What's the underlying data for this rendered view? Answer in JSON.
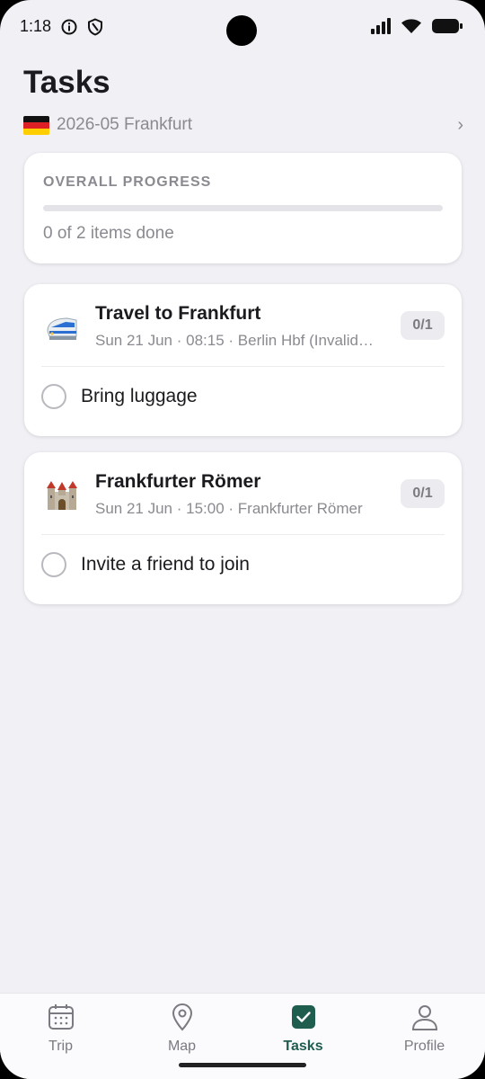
{
  "status": {
    "time": "1:18"
  },
  "header": {
    "title": "Tasks",
    "trip_name": "2026-05 Frankfurt",
    "chevron": "›"
  },
  "progress": {
    "label": "OVERALL PROGRESS",
    "text": "0 of 2 items done",
    "fraction": 0
  },
  "events": [
    {
      "emoji": "🚄",
      "title": "Travel to Frankfurt",
      "subtitle": "Sun 21 Jun · 08:15 · Berlin Hbf (Invalid…",
      "count": "0/1",
      "tasks": [
        {
          "label": "Bring luggage",
          "done": false
        }
      ]
    },
    {
      "emoji": "🏰",
      "title": "Frankfurter Römer",
      "subtitle": "Sun 21 Jun · 15:00 · Frankfurter Römer",
      "count": "0/1",
      "tasks": [
        {
          "label": "Invite a friend to join",
          "done": false
        }
      ]
    }
  ],
  "tabs": [
    {
      "label": "Trip",
      "icon": "calendar-icon",
      "active": false
    },
    {
      "label": "Map",
      "icon": "map-pin-icon",
      "active": false
    },
    {
      "label": "Tasks",
      "icon": "checkbox-icon",
      "active": true
    },
    {
      "label": "Profile",
      "icon": "person-icon",
      "active": false
    }
  ],
  "colors": {
    "accent": "#1f5e4f",
    "background": "#f1f0f5",
    "muted_text": "#8a8a90"
  }
}
